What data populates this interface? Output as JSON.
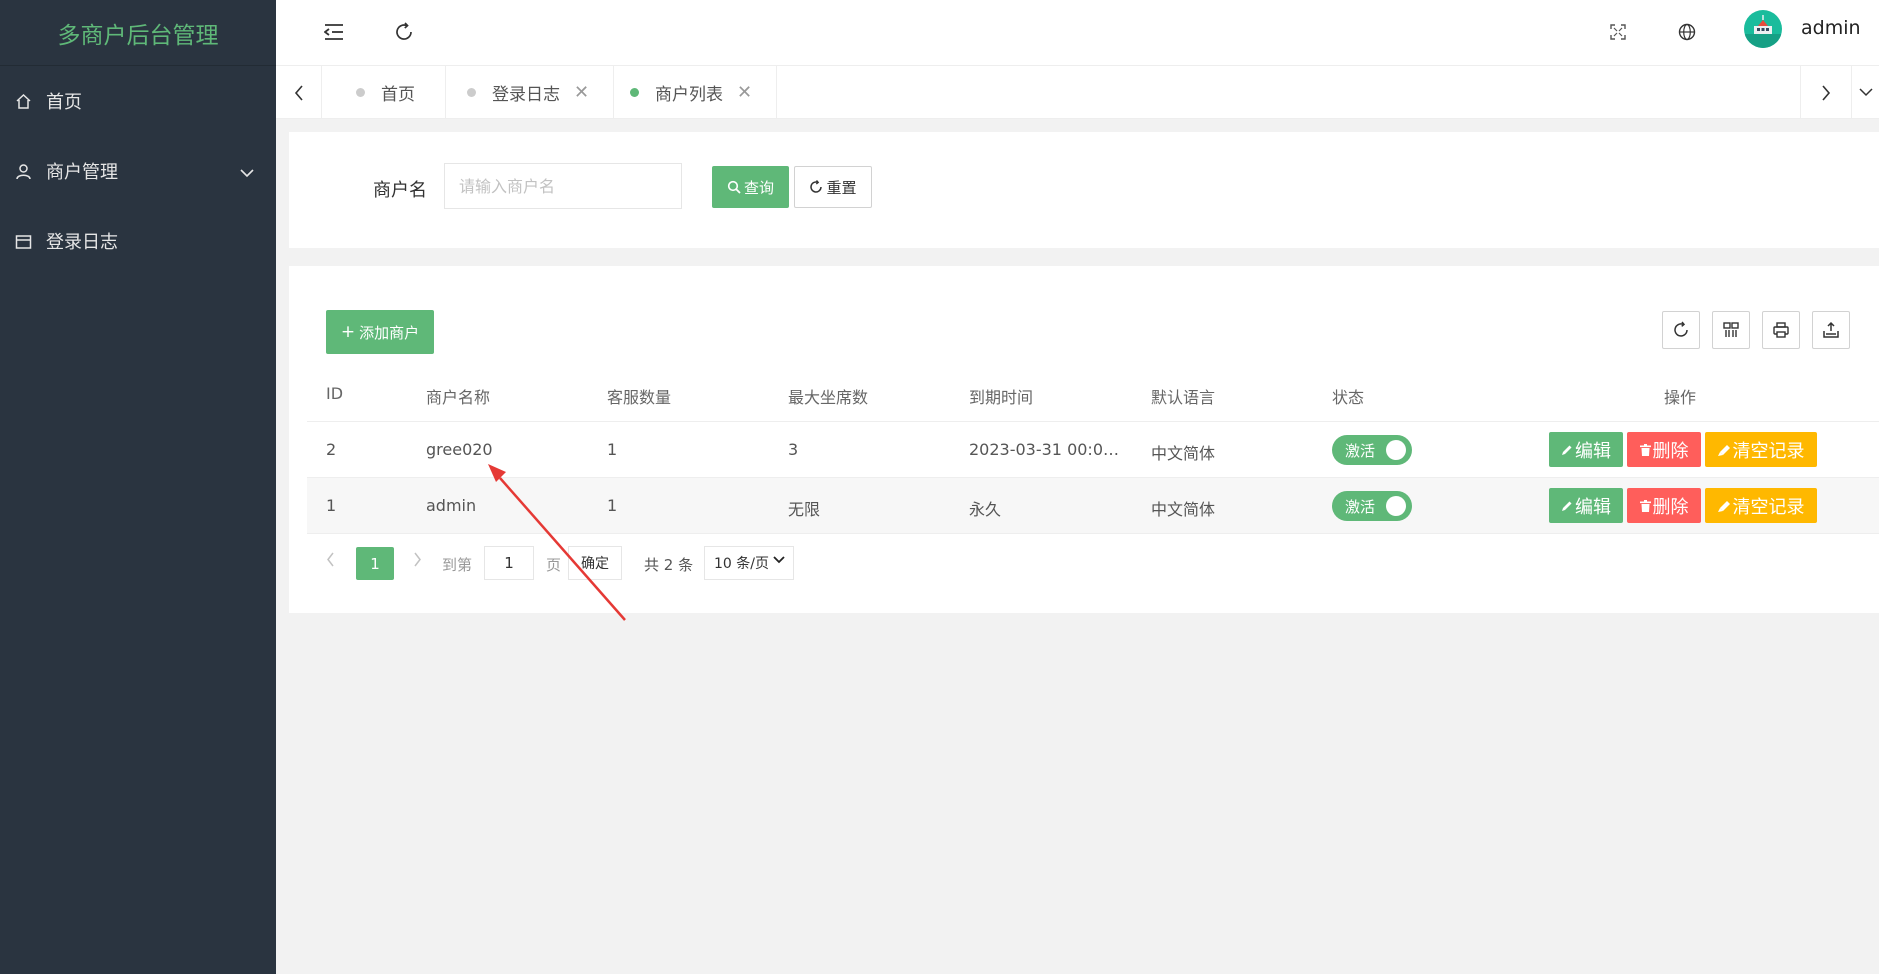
{
  "sidebar": {
    "brand": "多商户后台管理",
    "items": [
      {
        "label": "首页",
        "icon": "home-icon"
      },
      {
        "label": "商户管理",
        "icon": "user-icon"
      },
      {
        "label": "登录日志",
        "icon": "calendar-icon"
      }
    ]
  },
  "header": {
    "username": "admin",
    "icons": [
      "menu-fold-icon",
      "refresh-icon",
      "fullscreen-icon",
      "globe-icon",
      "avatar"
    ]
  },
  "tabs": [
    {
      "label": "首页",
      "closable": false,
      "active": false
    },
    {
      "label": "登录日志",
      "closable": true,
      "active": false
    },
    {
      "label": "商户列表",
      "closable": true,
      "active": true
    }
  ],
  "tab_close_glyph": "✕",
  "search": {
    "label": "商户名",
    "placeholder": "请输入商户名",
    "value": "",
    "query_label": "查询",
    "reset_label": "重置"
  },
  "table": {
    "add_label": "添加商户",
    "columns": [
      "ID",
      "商户名称",
      "客服数量",
      "最大坐席数",
      "到期时间",
      "默认语言",
      "状态",
      "操作"
    ],
    "rows": [
      {
        "id": "2",
        "name": "gree020",
        "agents": "1",
        "max_seats": "3",
        "expire": "2023-03-31 00:0…",
        "language": "中文简体",
        "status": "激活"
      },
      {
        "id": "1",
        "name": "admin",
        "agents": "1",
        "max_seats": "无限",
        "expire": "永久",
        "language": "中文简体",
        "status": "激活"
      }
    ],
    "actions": {
      "edit": "编辑",
      "delete": "删除",
      "clear": "清空记录"
    }
  },
  "pagination": {
    "current_page": "1",
    "goto_label": "到第",
    "goto_value": "1",
    "page_unit": "页",
    "confirm_label": "确定",
    "total_label": "共 2 条",
    "page_size_label": "10 条/页"
  },
  "colors": {
    "sidebar_bg": "#2a3440",
    "brand_green": "#5fb878",
    "danger": "#ff5e5b",
    "warning": "#ffb800",
    "annotation_arrow": "#e53935"
  }
}
